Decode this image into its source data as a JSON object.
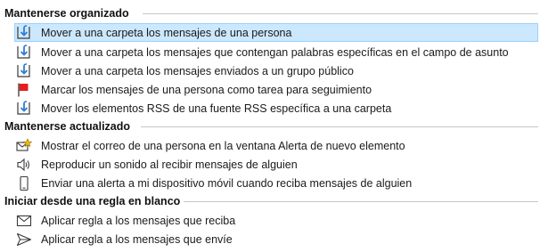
{
  "sections": [
    {
      "title": "Mantenerse organizado",
      "items": [
        {
          "label": "Mover a una carpeta los mensajes de una persona",
          "icon": "move-to-folder-icon",
          "selected": true
        },
        {
          "label": "Mover a una carpeta los mensajes que contengan palabras específicas en el campo de asunto",
          "icon": "move-to-folder-icon",
          "selected": false
        },
        {
          "label": "Mover a una carpeta los mensajes enviados a un grupo público",
          "icon": "move-to-folder-icon",
          "selected": false
        },
        {
          "label": "Marcar los mensajes de una persona como tarea para seguimiento",
          "icon": "red-flag-icon",
          "selected": false
        },
        {
          "label": "Mover los elementos RSS de una fuente RSS específica a una carpeta",
          "icon": "move-to-folder-icon",
          "selected": false
        }
      ]
    },
    {
      "title": "Mantenerse actualizado",
      "items": [
        {
          "label": "Mostrar el correo de una persona en la ventana Alerta de nuevo elemento",
          "icon": "mail-star-alert-icon",
          "selected": false
        },
        {
          "label": "Reproducir un sonido al recibir mensajes de alguien",
          "icon": "speaker-icon",
          "selected": false
        },
        {
          "label": "Enviar una alerta a mi dispositivo móvil cuando reciba mensajes de alguien",
          "icon": "mobile-phone-icon",
          "selected": false
        }
      ]
    },
    {
      "title": "Iniciar desde una regla en blanco",
      "items": [
        {
          "label": "Aplicar regla a los mensajes que reciba",
          "icon": "envelope-icon",
          "selected": false
        },
        {
          "label": "Aplicar regla a los mensajes que envíe",
          "icon": "send-arrow-icon",
          "selected": false
        }
      ]
    }
  ],
  "colors": {
    "selection_bg": "#cce8ff",
    "selection_border": "#99d1ff",
    "folder_arrow": "#2b7cd3",
    "flag_red": "#e0201f"
  }
}
